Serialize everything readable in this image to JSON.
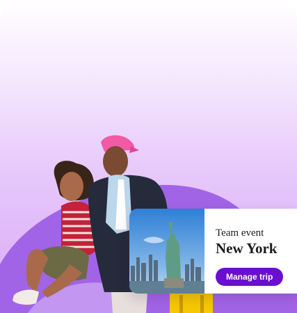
{
  "trip_card": {
    "label": "Team event",
    "city": "New York",
    "cta_label": "Manage trip"
  },
  "colors": {
    "accent": "#6a0fd1",
    "blob": "#a264e6",
    "background_top": "#ffffff",
    "background_bottom": "#d9a9f6"
  }
}
